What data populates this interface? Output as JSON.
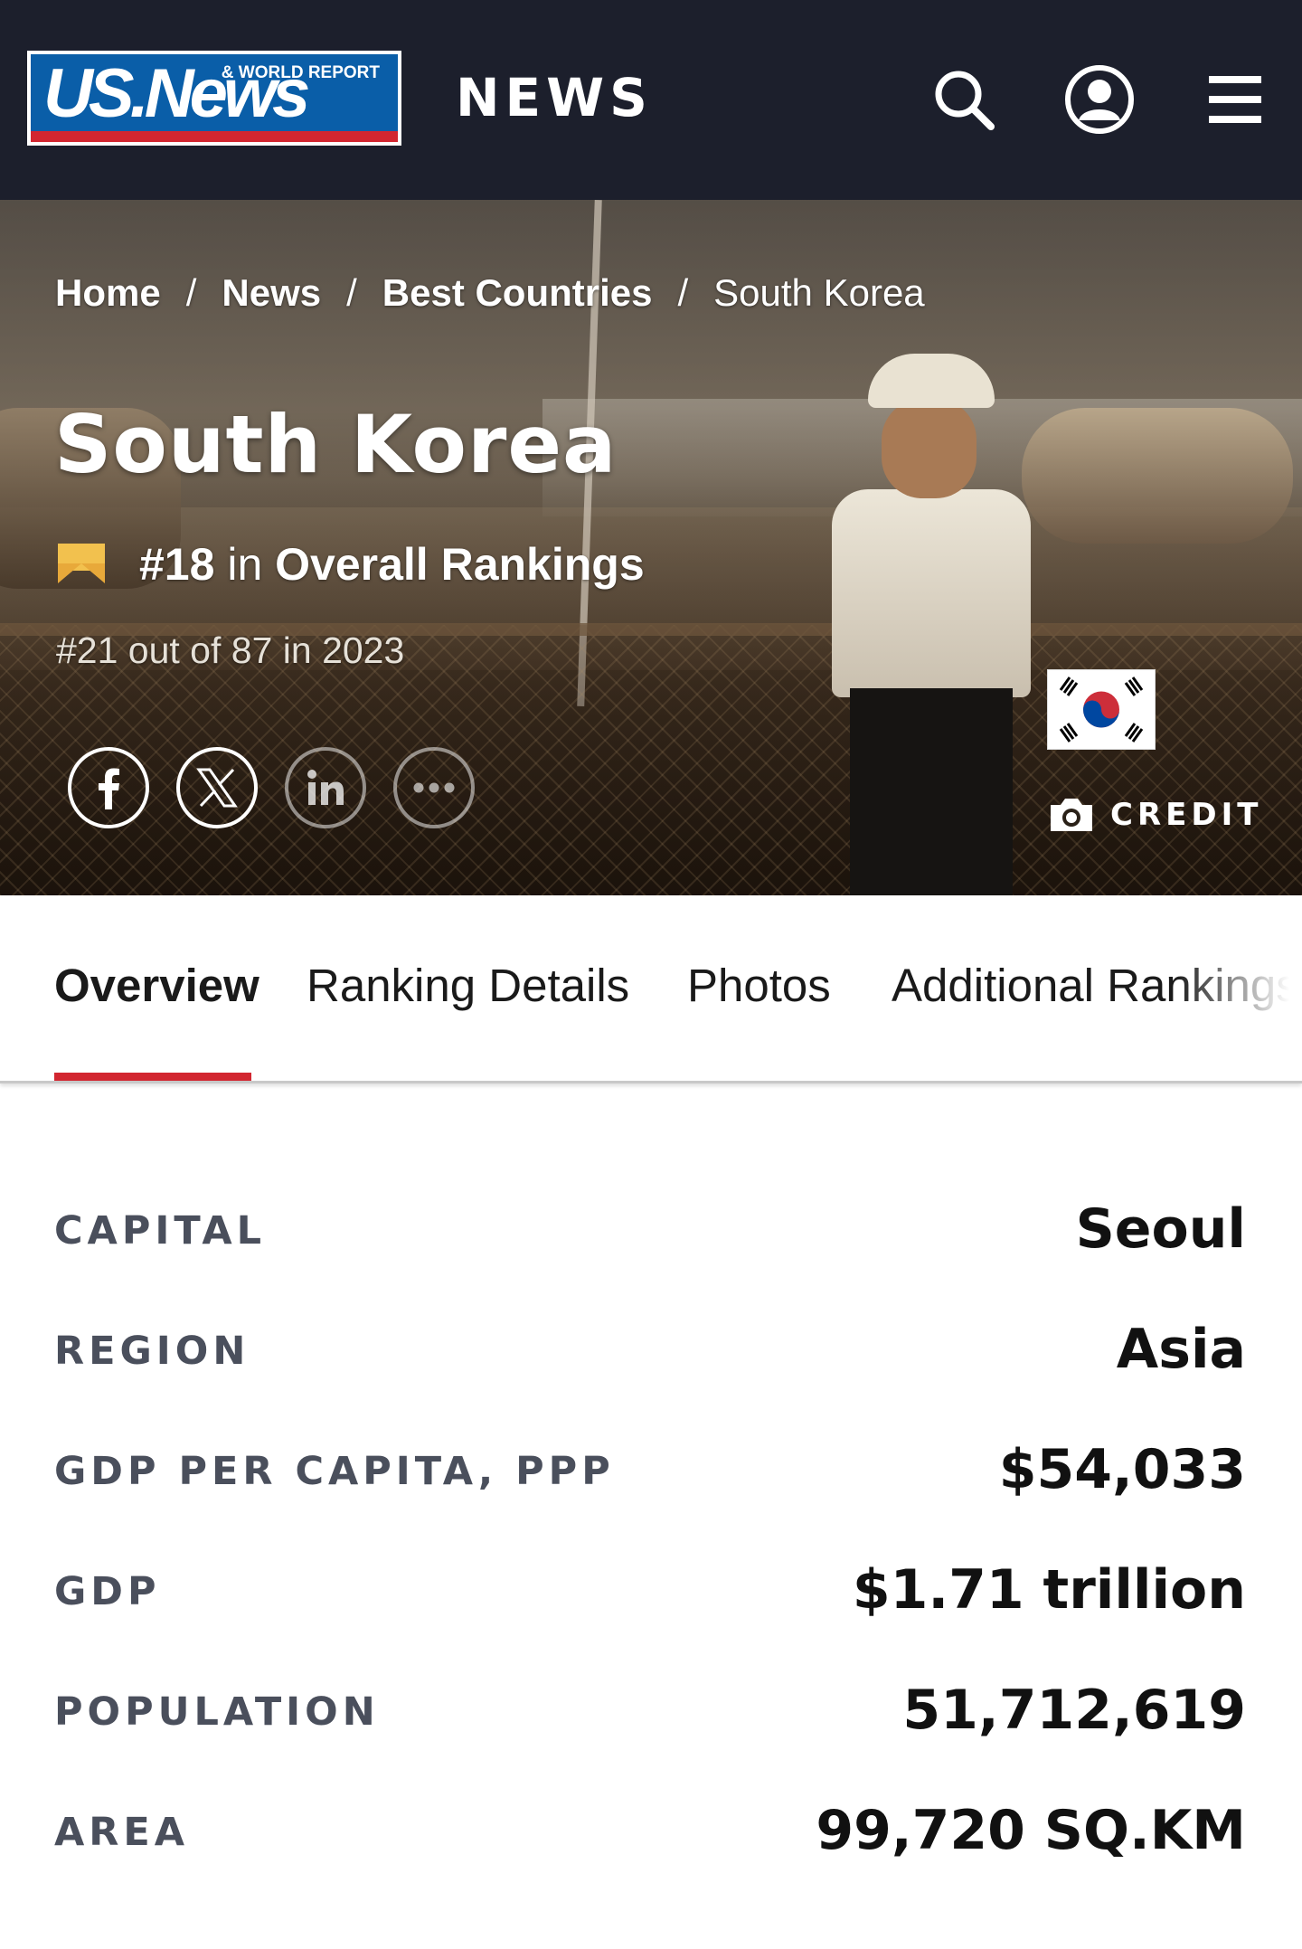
{
  "header": {
    "logo_main": "US.News",
    "logo_sub": "& WORLD REPORT",
    "section_label": "NEWS",
    "icons": [
      "search-icon",
      "account-icon",
      "menu-icon"
    ],
    "background_color": "#1c1f2c"
  },
  "breadcrumb": {
    "items": [
      "Home",
      "News",
      "Best Countries",
      "South Korea"
    ],
    "separator": "/"
  },
  "hero": {
    "title": "South Korea",
    "rank": "#18",
    "rank_in": " in ",
    "rank_category": "Overall Rankings",
    "previous_rank": "#21 out of 87 in 2023",
    "share_icons": [
      "facebook-icon",
      "x-icon",
      "linkedin-icon",
      "more-icon"
    ],
    "credit_label": "CREDIT"
  },
  "tabs": [
    {
      "label": "Overview",
      "active": true
    },
    {
      "label": "Ranking Details",
      "active": false
    },
    {
      "label": "Photos",
      "active": false
    },
    {
      "label": "Additional Rankings",
      "active": false
    }
  ],
  "facts": [
    {
      "label": "CAPITAL",
      "value": "Seoul"
    },
    {
      "label": "REGION",
      "value": "Asia"
    },
    {
      "label": "GDP PER CAPITA, PPP",
      "value": "$54,033"
    },
    {
      "label": "GDP",
      "value": "$1.71 trillion"
    },
    {
      "label": "POPULATION",
      "value": "51,712,619"
    },
    {
      "label": "AREA",
      "value": "99,720 SQ.KM"
    }
  ],
  "colors": {
    "accent_red": "#d22630",
    "logo_blue": "#0a5ea8",
    "label_gray": "#4a4f5c",
    "rank_badge_yellow": "#f2c14e"
  }
}
